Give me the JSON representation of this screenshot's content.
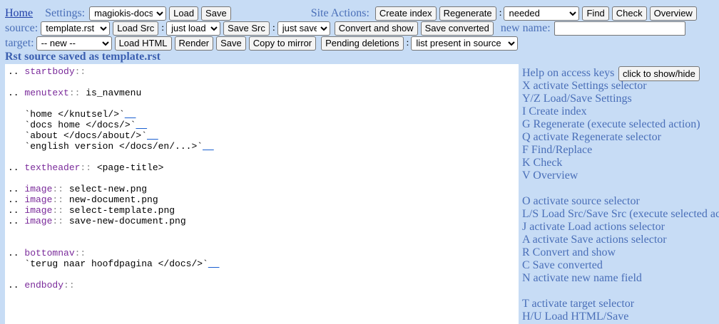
{
  "top": {
    "home_link": "Home",
    "settings_label": "Settings:",
    "settings_selected": "magiokis-docs",
    "load_label": "Load",
    "save_label": "Save",
    "site_actions_label": "Site Actions:",
    "create_index_label": "Create index",
    "regenerate_label": "Regenerate",
    "regen_selected": "needed",
    "find_label": "Find",
    "check_label": "Check",
    "overview_label": "Overview"
  },
  "source": {
    "label": "source:",
    "file_selected": "template.rst",
    "load_src_label": "Load Src",
    "load_action_selected": "just load",
    "save_src_label": "Save Src",
    "save_action_selected": "just save",
    "convert_show_label": "Convert and show",
    "save_converted_label": "Save converted",
    "new_name_label": "new name:",
    "new_name_value": ""
  },
  "target": {
    "label": "target:",
    "selected": "-- new --",
    "load_html_label": "Load HTML",
    "render_label": "Render",
    "save_label": "Save",
    "copy_mirror_label": "Copy to mirror",
    "pending_deletions_label": "Pending deletions",
    "deletions_selected": "list present in source"
  },
  "status_message": "Rst source saved as template.rst",
  "editor": {
    "lines": [
      {
        "pre": ".. ",
        "dir": "startbody",
        "rest": ""
      },
      {
        "pre": ".. ",
        "dir": "menutext",
        "rest": " is_navmenu"
      },
      {
        "text": "   `home </knutsel/>`",
        "link": "__"
      },
      {
        "text": "   `docs home </docs/>`",
        "link": "__"
      },
      {
        "text": "   `about </docs/about/>`",
        "link": "__"
      },
      {
        "text": "   `english version </docs/en/...>`",
        "link": "__"
      },
      {
        "pre": ".. ",
        "dir": "textheader",
        "rest": " <page-title>"
      },
      {
        "pre": ".. ",
        "dir": "image",
        "rest": " select-new.png"
      },
      {
        "pre": ".. ",
        "dir": "image",
        "rest": " new-document.png"
      },
      {
        "pre": ".. ",
        "dir": "image",
        "rest": " select-template.png"
      },
      {
        "pre": ".. ",
        "dir": "image",
        "rest": " save-new-document.png"
      },
      {
        "pre": ".. ",
        "dir": "bottomnav",
        "rest": ""
      },
      {
        "text": "   `terug naar hoofdpagina </docs/>`",
        "link": "__"
      },
      {
        "pre": ".. ",
        "dir": "endbody",
        "rest": ""
      }
    ]
  },
  "help": {
    "title": "Help on access keys",
    "button_label": "click to show/hide",
    "items": [
      "X activate Settings selector",
      "Y/Z Load/Save Settings",
      "I Create index",
      "G Regenerate (execute selected action)",
      "Q activate Regenerate selector",
      "F Find/Replace",
      "K Check",
      "V Overview",
      "O activate source selector",
      "L/S Load Src/Save Src (execute selected actions)",
      "J activate Load actions selector",
      "A activate Save actions selector",
      "R Convert and show",
      "C Save converted",
      "N activate new name field",
      "T activate target selector",
      "H/U Load HTML/Save"
    ]
  }
}
